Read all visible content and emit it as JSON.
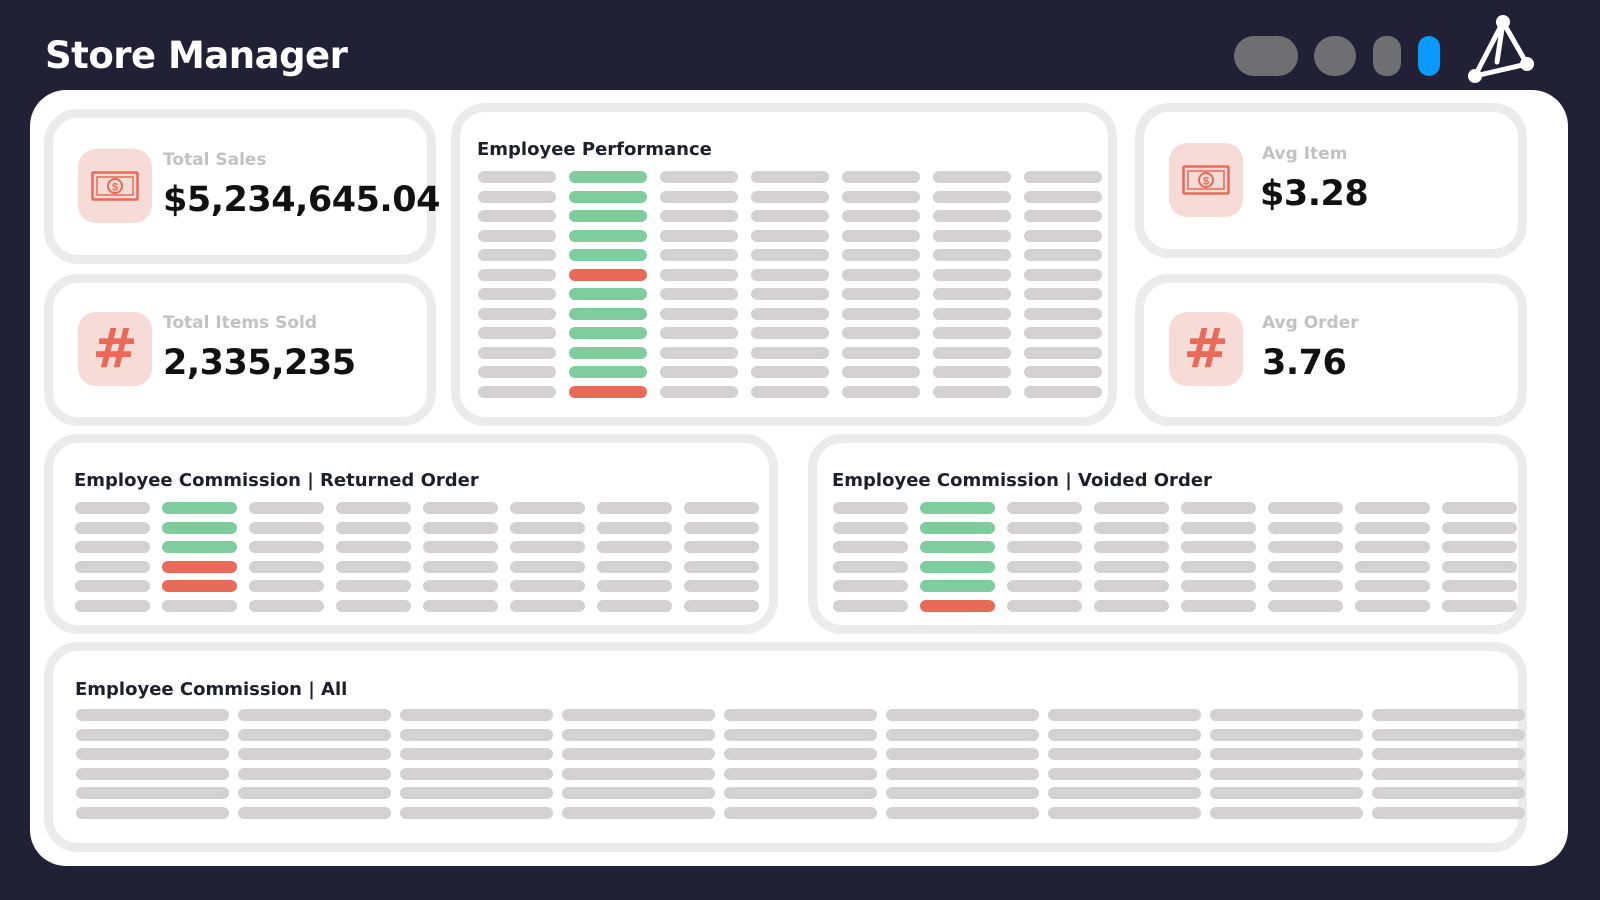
{
  "app": {
    "title": "Store Manager"
  },
  "toolbar": {
    "buttons": [
      {
        "name": "toolbar-pill-1",
        "color": "#6f6f71"
      },
      {
        "name": "toolbar-pill-2",
        "color": "#6f6f71"
      },
      {
        "name": "toolbar-pill-3",
        "color": "#6f6f71"
      },
      {
        "name": "toolbar-pill-4",
        "color": "#0a9aff"
      }
    ],
    "logo": "network-triangle-logo"
  },
  "kpis": {
    "total_sales": {
      "label": "Total Sales",
      "value": "$5,234,645.04",
      "icon": "dollar-bill-icon"
    },
    "total_items_sold": {
      "label": "Total Items Sold",
      "value": "2,335,235",
      "icon": "hash-icon",
      "glyph": "#"
    },
    "avg_item": {
      "label": "Avg Item",
      "value": "$3.28",
      "icon": "dollar-bill-icon"
    },
    "avg_order": {
      "label": "Avg Order",
      "value": "3.76",
      "icon": "hash-icon",
      "glyph": "#"
    }
  },
  "tables": {
    "employee_performance": {
      "title": "Employee Performance",
      "columns": 7,
      "rows": 12,
      "status_column": 2,
      "status": [
        "good",
        "good",
        "good",
        "good",
        "good",
        "bad",
        "good",
        "good",
        "good",
        "good",
        "good",
        "bad"
      ]
    },
    "commission_returned": {
      "title": "Employee Commission | Returned Order",
      "columns": 8,
      "rows": 6,
      "status_column": 2,
      "status": [
        "good",
        "good",
        "good",
        "bad",
        "bad",
        "none"
      ]
    },
    "commission_voided": {
      "title": "Employee Commission | Voided Order",
      "columns": 8,
      "rows": 6,
      "status_column": 2,
      "status": [
        "good",
        "good",
        "good",
        "good",
        "good",
        "bad"
      ]
    },
    "commission_all": {
      "title": "Employee Commission | All",
      "columns": 9,
      "rows": 6,
      "status_column": 0,
      "status": []
    }
  },
  "colors": {
    "background": "#212035",
    "placeholder": "#d3d1d1",
    "good": "#7fcc9f",
    "bad": "#e86a58",
    "accent": "#0a9aff",
    "icon_tile": "#f7dbd7"
  }
}
